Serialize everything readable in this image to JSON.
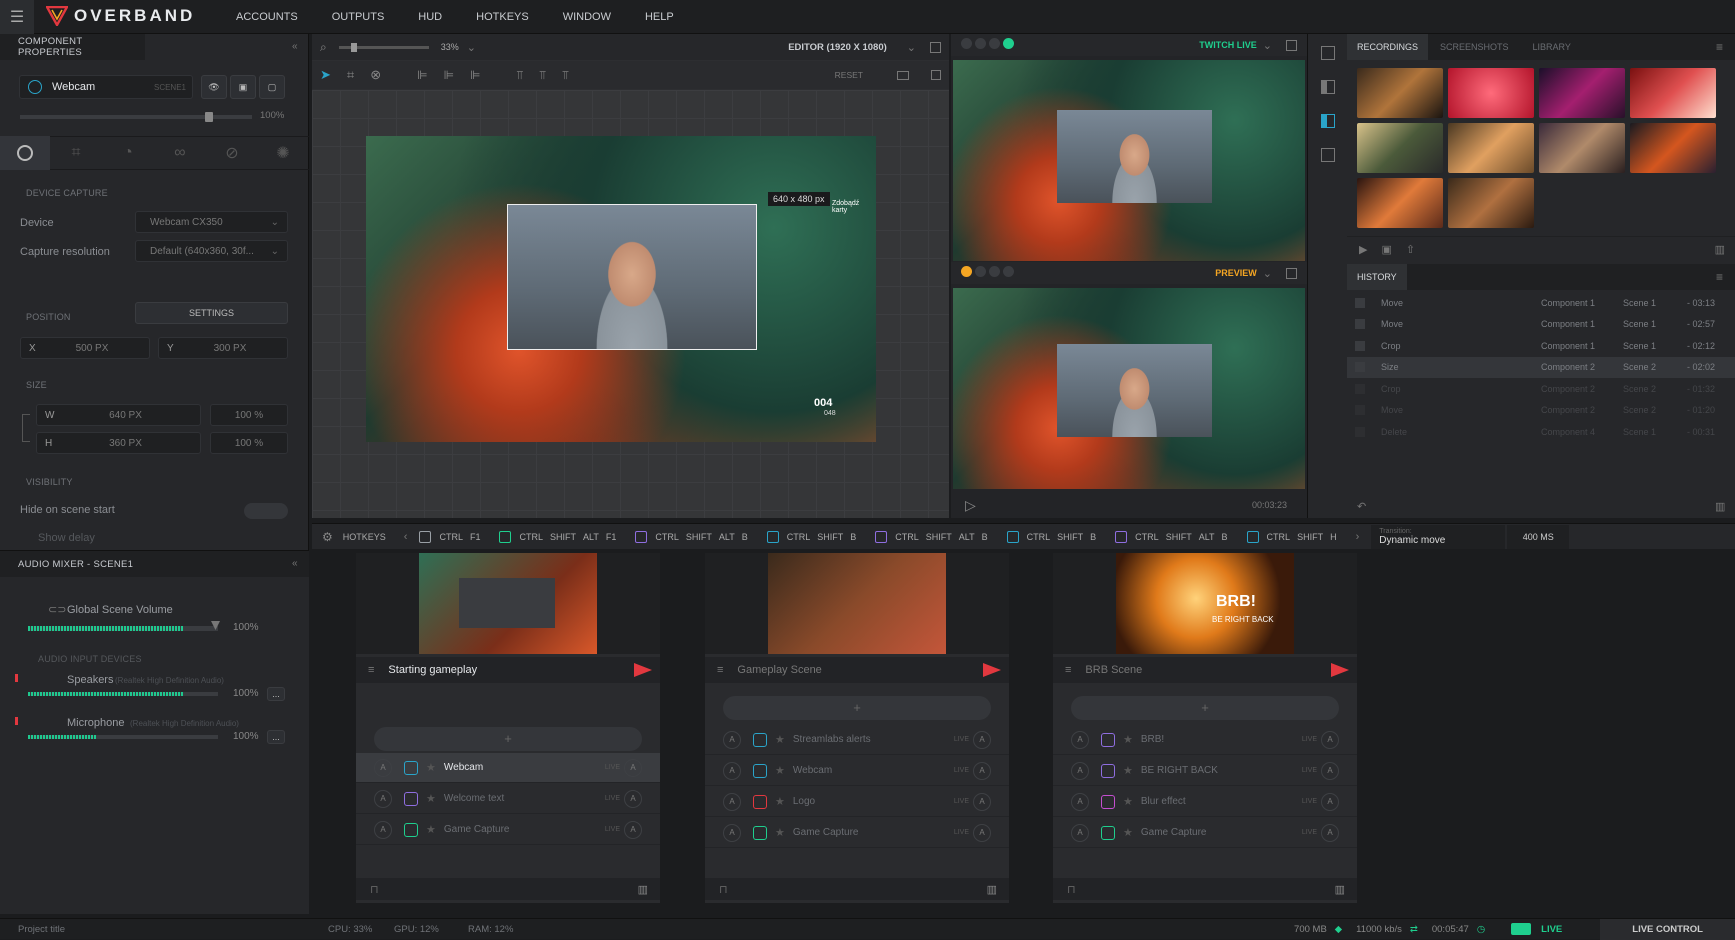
{
  "app": {
    "brand": "OVERBAND",
    "accent": "#1fcf8e",
    "brand_accent": "#e2383f"
  },
  "menu": [
    "ACCOUNTS",
    "OUTPUTS",
    "HUD",
    "HOTKEYS",
    "WINDOW",
    "HELP"
  ],
  "component_properties": {
    "header": "COMPONENT PROPERTIES",
    "component_name": "Webcam",
    "scene_tag": "SCENE1",
    "opacity": "100%",
    "device_capture_label": "DEVICE CAPTURE",
    "device_label": "Device",
    "device_value": "Webcam CX350",
    "resolution_label": "Capture resolution",
    "resolution_value": "Default (640x360, 30f...",
    "settings_button": "SETTINGS",
    "position_label": "POSITION",
    "x_label": "X",
    "x_value": "500 PX",
    "y_label": "Y",
    "y_value": "300 PX",
    "size_label": "SIZE",
    "w_label": "W",
    "w_value": "640 PX",
    "w_percent": "100 %",
    "h_label": "H",
    "h_value": "360 PX",
    "h_percent": "100 %",
    "visibility_label": "VISIBILITY",
    "hide_on_start": "Hide on scene start",
    "show_delay": "Show delay"
  },
  "audio_mixer": {
    "header": "AUDIO MIXER - SCENE1",
    "global_label": "Global Scene Volume",
    "global_value": "100%",
    "devices_label": "AUDIO INPUT DEVICES",
    "speakers_label": "Speakers",
    "speakers_sub": "(Realtek High Definition Audio)",
    "speakers_value": "100%",
    "mic_label": "Microphone",
    "mic_sub": "(Realtek High Definition Audio)",
    "mic_value": "100%",
    "more": "..."
  },
  "editor": {
    "zoom": "33%",
    "title": "EDITOR (1920 X 1080)",
    "reset": "RESET",
    "selection_size": "640 x 480 px",
    "overlay_text": "Zdobądź karty",
    "hud_number": "004",
    "hud_sub": "048"
  },
  "preview": {
    "live_label": "TWITCH LIVE",
    "preview_label": "PREVIEW",
    "time": "00:03:23"
  },
  "right_tabs": [
    "RECORDINGS",
    "SCREENSHOTS",
    "LIBRARY"
  ],
  "history": {
    "header": "HISTORY",
    "rows": [
      {
        "action": "Move",
        "component": "Component 1",
        "scene": "Scene 1",
        "time": "- 03:13"
      },
      {
        "action": "Move",
        "component": "Component 1",
        "scene": "Scene 1",
        "time": "- 02:57"
      },
      {
        "action": "Crop",
        "component": "Component 1",
        "scene": "Scene 1",
        "time": "- 02:12"
      },
      {
        "action": "Size",
        "component": "Component 2",
        "scene": "Scene 2",
        "time": "- 02:02"
      },
      {
        "action": "Crop",
        "component": "Component 2",
        "scene": "Scene 2",
        "time": "- 01:32"
      },
      {
        "action": "Move",
        "component": "Component 2",
        "scene": "Scene 2",
        "time": "- 01:20"
      },
      {
        "action": "Delete",
        "component": "Component 4",
        "scene": "Scene 1",
        "time": "- 00:31"
      }
    ]
  },
  "hotkeys": {
    "label": "HOTKEYS",
    "groups": [
      [
        "CTRL",
        "F1"
      ],
      [
        "CTRL",
        "SHIFT",
        "ALT",
        "F1"
      ],
      [
        "CTRL",
        "SHIFT",
        "ALT",
        "B"
      ],
      [
        "CTRL",
        "SHIFT",
        "B"
      ],
      [
        "CTRL",
        "SHIFT",
        "ALT",
        "B"
      ],
      [
        "CTRL",
        "SHIFT",
        "B"
      ],
      [
        "CTRL",
        "SHIFT",
        "ALT",
        "B"
      ],
      [
        "CTRL",
        "SHIFT",
        "H"
      ]
    ],
    "transition_label": "Transition:",
    "transition_value": "Dynamic move",
    "transition_time": "400 MS"
  },
  "scenes": [
    {
      "name": "Starting gameplay",
      "active": true,
      "sources": [
        {
          "name": "Webcam",
          "color": "#2aa4c9"
        },
        {
          "name": "Welcome text",
          "color": "#8f6ee0"
        },
        {
          "name": "Game Capture",
          "color": "#1fcf8e"
        }
      ]
    },
    {
      "name": "Gameplay Scene",
      "active": false,
      "sources": [
        {
          "name": "Streamlabs alerts",
          "color": "#2aa4c9"
        },
        {
          "name": "Webcam",
          "color": "#2aa4c9"
        },
        {
          "name": "Logo",
          "color": "#e2383f"
        },
        {
          "name": "Game Capture",
          "color": "#1fcf8e"
        }
      ]
    },
    {
      "name": "BRB Scene",
      "active": false,
      "sources": [
        {
          "name": "BRB!",
          "color": "#8f6ee0"
        },
        {
          "name": "BE RIGHT BACK",
          "color": "#8f6ee0"
        },
        {
          "name": "Blur effect",
          "color": "#c54fd1"
        },
        {
          "name": "Game Capture",
          "color": "#1fcf8e"
        }
      ]
    }
  ],
  "scene_live_tag": "LIVE",
  "scene_add": "+",
  "brb_big": "BRB!",
  "brb_small": "BE RIGHT BACK",
  "status": {
    "project": "Project title",
    "cpu": "CPU: 33%",
    "gpu": "GPU: 12%",
    "ram": "RAM: 12%",
    "memory": "700 MB",
    "bitrate": "11000 kb/s",
    "time": "00:05:47",
    "live": "LIVE",
    "live_control": "LIVE CONTROL"
  }
}
